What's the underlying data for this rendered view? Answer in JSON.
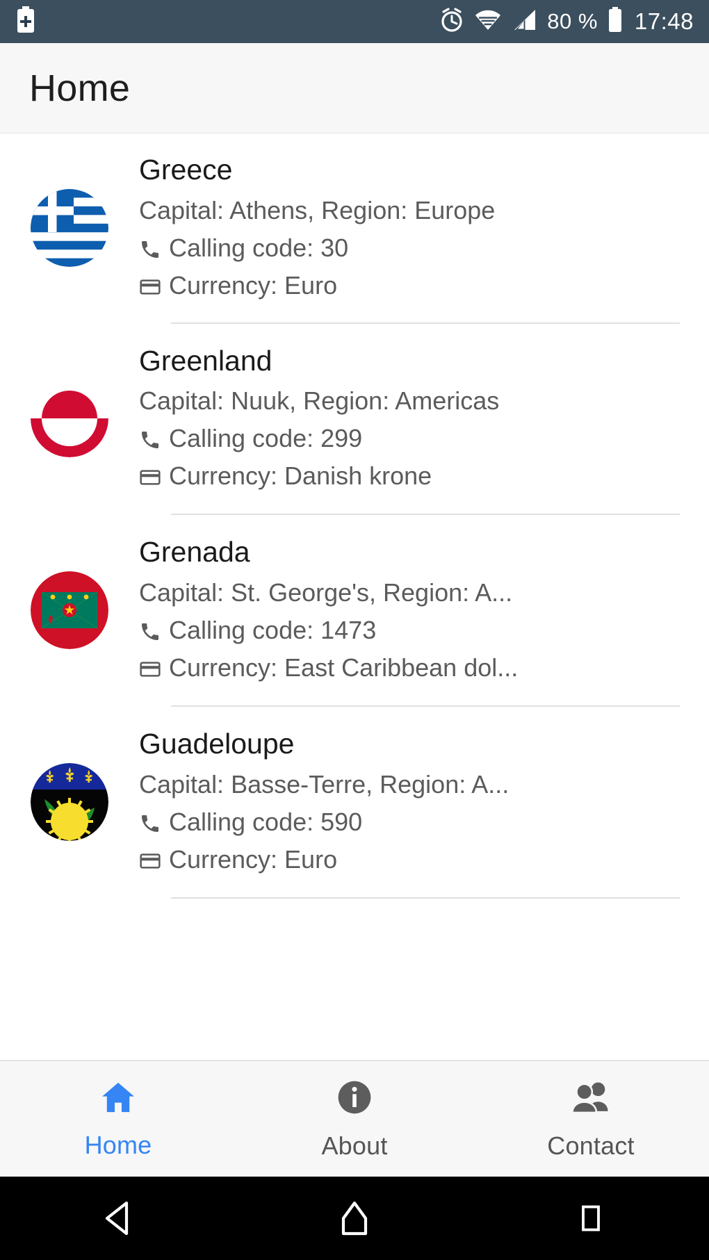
{
  "status_bar": {
    "battery_plus_icon": "battery-plus-icon",
    "alarm_icon": "alarm-clock-icon",
    "wifi_icon": "wifi-icon",
    "signal_icon": "cellular-signal-icon",
    "battery_percent": "80 %",
    "battery_icon": "battery-icon",
    "clock": "17:48",
    "background_color": "#3b4f5e",
    "foreground_color": "#ffffff"
  },
  "appbar": {
    "title": "Home",
    "background_color": "#f7f7f7"
  },
  "list": {
    "items": [
      {
        "name": "Greece",
        "capital_region": "Capital: Athens, Region: Europe",
        "calling_code": "Calling code: 30",
        "currency": "Currency: Euro",
        "flag_icon": "flag-greece-icon"
      },
      {
        "name": "Greenland",
        "capital_region": "Capital: Nuuk, Region: Americas",
        "calling_code": "Calling code: 299",
        "currency": "Currency: Danish krone",
        "flag_icon": "flag-greenland-icon"
      },
      {
        "name": "Grenada",
        "capital_region": "Capital: St. George's, Region: A...",
        "calling_code": "Calling code: 1473",
        "currency": "Currency: East Caribbean dol...",
        "flag_icon": "flag-grenada-icon"
      },
      {
        "name": "Guadeloupe",
        "capital_region": "Capital: Basse-Terre, Region: A...",
        "calling_code": "Calling code: 590",
        "currency": "Currency: Euro",
        "flag_icon": "flag-guadeloupe-icon"
      }
    ],
    "phone_icon": "phone-icon",
    "card_icon": "credit-card-icon"
  },
  "tabbar": {
    "active_color": "#3585f4",
    "inactive_color": "#555555",
    "tabs": [
      {
        "label": "Home",
        "icon": "home-icon",
        "active": true
      },
      {
        "label": "About",
        "icon": "info-icon",
        "active": false
      },
      {
        "label": "Contact",
        "icon": "people-icon",
        "active": false
      }
    ]
  },
  "navbar": {
    "back": "back-triangle-icon",
    "home": "home-pentagon-icon",
    "recents": "recents-square-icon"
  }
}
